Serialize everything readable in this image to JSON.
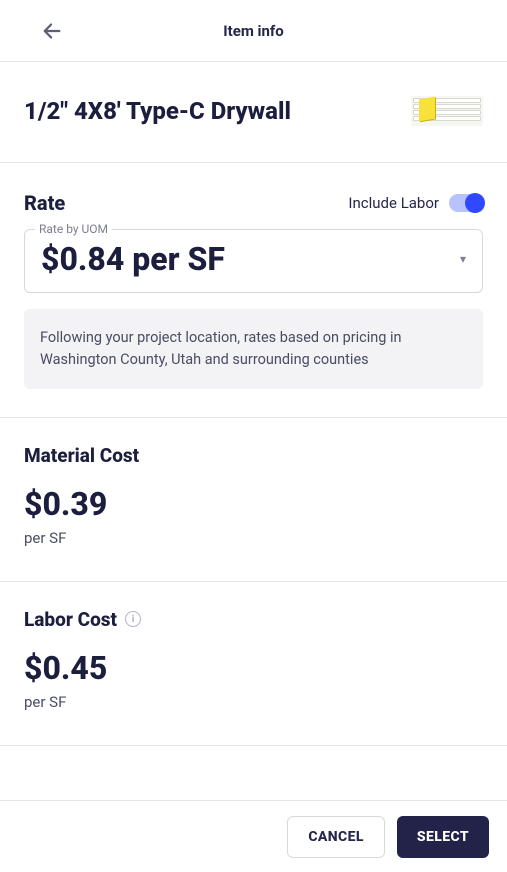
{
  "header": {
    "title": "Item info"
  },
  "item": {
    "title": "1/2\" 4X8' Type-C Drywall"
  },
  "rate": {
    "heading": "Rate",
    "include_labor_label": "Include Labor",
    "select_legend": "Rate by UOM",
    "select_value": "$0.84 per SF",
    "info_text": "Following your project location, rates based on pricing in Washington County, Utah and surrounding counties"
  },
  "material": {
    "title": "Material Cost",
    "value": "$0.39",
    "unit": "per SF"
  },
  "labor": {
    "title": "Labor Cost",
    "value": "$0.45",
    "unit": "per SF"
  },
  "footer": {
    "cancel_label": "CANCEL",
    "select_label": "SELECT"
  }
}
